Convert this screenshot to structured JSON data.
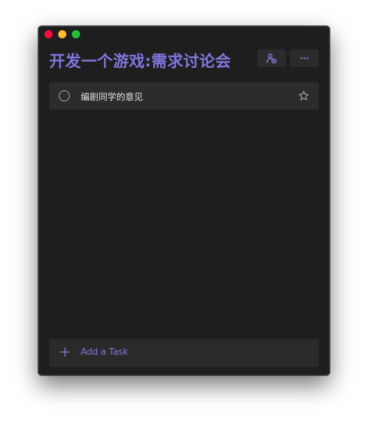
{
  "window": {
    "controls": [
      "close",
      "minimize",
      "maximize"
    ]
  },
  "header": {
    "title": "开发一个游戏:需求讨论会",
    "share_icon": "share-person-icon",
    "more_icon": "more-horizontal-icon"
  },
  "tasks": [
    {
      "label": "编剧同学的意见",
      "completed": false,
      "starred": false
    }
  ],
  "add_task": {
    "label": "Add a Task",
    "icon": "plus-icon"
  },
  "colors": {
    "accent": "#7f77dd",
    "background": "#1e1e1e",
    "row": "#2c2c2c",
    "text": "#e6e6e6"
  }
}
